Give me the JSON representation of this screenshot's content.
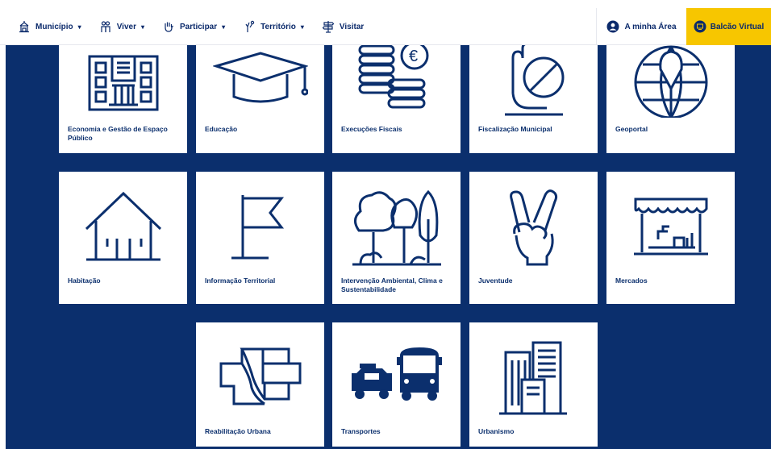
{
  "nav": {
    "items": [
      {
        "label": "Município",
        "icon": "building-icon",
        "caret": "▾"
      },
      {
        "label": "Viver",
        "icon": "people-icon",
        "caret": "▾"
      },
      {
        "label": "Participar",
        "icon": "hand-icon",
        "caret": "▾"
      },
      {
        "label": "Território",
        "icon": "pin-hand-icon",
        "caret": "▾"
      },
      {
        "label": "Visitar",
        "icon": "signpost-icon",
        "caret": ""
      }
    ],
    "area_label": "A minha Área",
    "balcao_label": "Balcão Virtual"
  },
  "colors": {
    "navy": "#0b2f6d",
    "accent": "#f7c600",
    "card": "#ffffff"
  },
  "cards": [
    {
      "label": "Economia e Gestão de Espaço Público",
      "icon": "building-facade-icon"
    },
    {
      "label": "Educação",
      "icon": "graduation-cap-icon"
    },
    {
      "label": "Execuções Fiscais",
      "icon": "coins-euro-icon"
    },
    {
      "label": "Fiscalização Municipal",
      "icon": "hand-stop-icon"
    },
    {
      "label": "Geoportal",
      "icon": "globe-pin-icon"
    },
    {
      "label": "Habitação",
      "icon": "house-icon"
    },
    {
      "label": "Informação Territorial",
      "icon": "flag-icon"
    },
    {
      "label": "Intervenção Ambiental, Clima e Sustentabilidade",
      "icon": "trees-icon"
    },
    {
      "label": "Juventude",
      "icon": "peace-hand-icon"
    },
    {
      "label": "Mercados",
      "icon": "market-stall-icon"
    },
    {
      "label": "Reabilitação Urbana",
      "icon": "urban-map-icon"
    },
    {
      "label": "Transportes",
      "icon": "taxi-bus-icon"
    },
    {
      "label": "Urbanismo",
      "icon": "buildings-icon"
    }
  ]
}
